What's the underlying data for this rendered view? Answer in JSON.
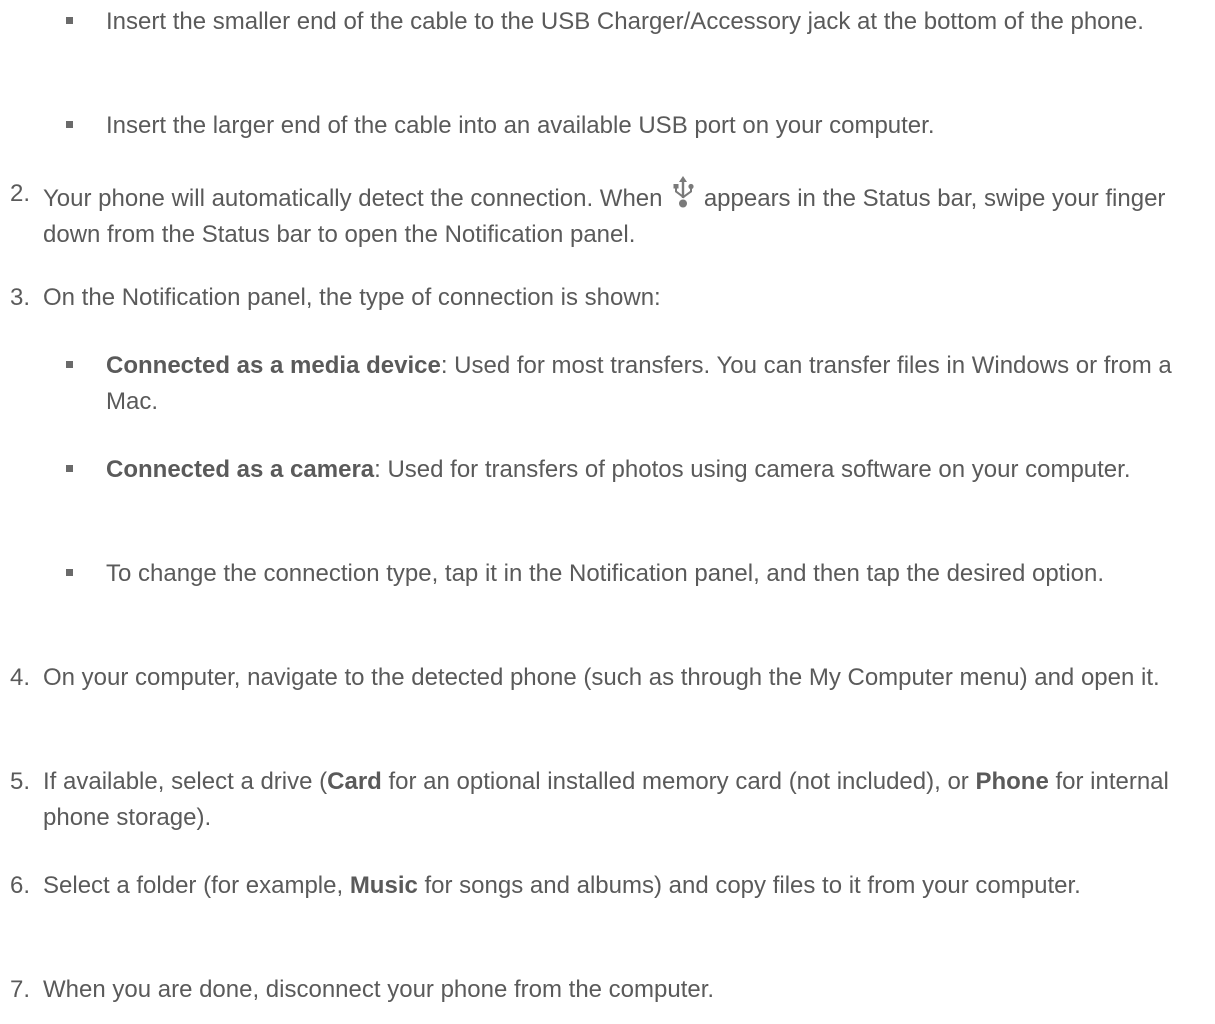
{
  "document": {
    "sub_a": {
      "text": "Insert the smaller end of the cable to the USB Charger/Accessory jack at the bottom of the phone."
    },
    "sub_b": {
      "text": "Insert the larger end of the cable into an available USB port on your computer."
    },
    "step2": {
      "num": "2.",
      "text_before": "Your phone will automatically detect the connection. When ",
      "icon": "usb-icon",
      "text_after": " appears in the Status bar, swipe your finger down from the Status bar to open the Notification panel."
    },
    "step3": {
      "num": "3.",
      "text": "On the Notification panel, the type of connection is shown:"
    },
    "step3_sub1": {
      "bold": "Connected as a media device",
      "text": ": Used for most transfers. You can transfer files in Windows or from a Mac."
    },
    "step3_sub2": {
      "bold": "Connected as a camera",
      "text": ": Used for transfers of photos using camera software on your computer."
    },
    "step3_sub3": {
      "text": "To change the connection type, tap it in the Notification panel, and then tap the desired option."
    },
    "step4": {
      "num": "4.",
      "text": "On your computer, navigate to the detected phone (such as through the My Computer menu) and open it."
    },
    "step5": {
      "num": "5.",
      "t1": "If available, select a drive (",
      "b1": "Card",
      "t2": " for an optional installed memory card (not included), or ",
      "b2": "Phone",
      "t3": " for internal phone storage)."
    },
    "step6": {
      "num": "6.",
      "t1": "Select a folder (for example, ",
      "b1": "Music",
      "t2": " for songs and albums) and copy files to it from your computer."
    },
    "step7": {
      "num": "7.",
      "text": "When you are done, disconnect your phone from the computer."
    }
  }
}
